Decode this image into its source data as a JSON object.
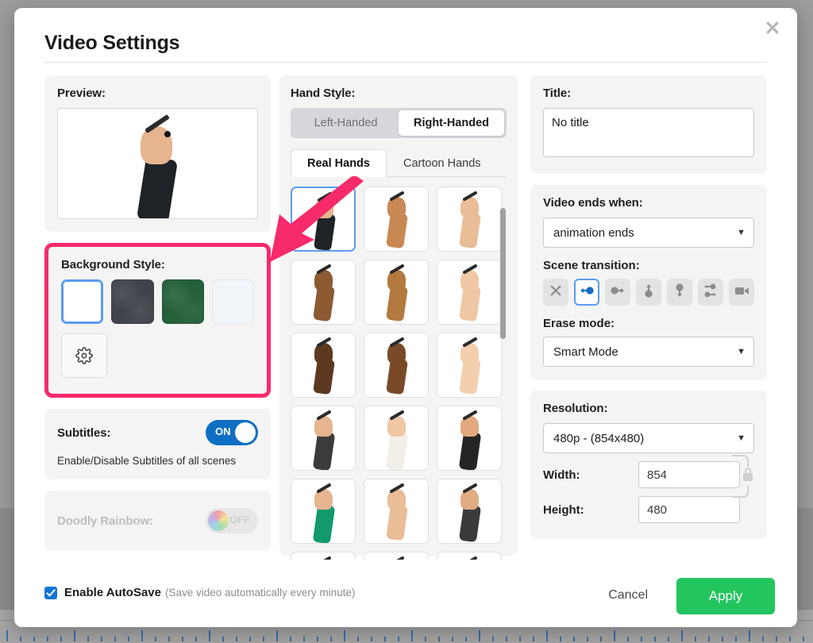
{
  "dialog": {
    "title": "Video Settings",
    "close_icon": "close-icon"
  },
  "left": {
    "preview": {
      "label": "Preview:"
    },
    "background_style": {
      "label": "Background Style:",
      "highlight_color": "#f72a6b",
      "swatches": [
        {
          "name": "white",
          "color": "#ffffff",
          "selected": true
        },
        {
          "name": "dark-chalkboard",
          "color": "#40434a",
          "selected": false
        },
        {
          "name": "green-chalkboard",
          "color": "#25603a",
          "selected": false
        },
        {
          "name": "light-gray",
          "color": "#f1f4f8",
          "selected": false
        }
      ],
      "settings_icon": "gear-icon"
    },
    "subtitles": {
      "label": "Subtitles:",
      "toggle_state": "ON",
      "hint": "Enable/Disable Subtitles of all scenes"
    },
    "doodly_rainbow": {
      "label": "Doodly Rainbow:",
      "toggle_state": "OFF",
      "disabled": true
    }
  },
  "middle": {
    "label": "Hand Style:",
    "handedness": {
      "options": [
        "Left-Handed",
        "Right-Handed"
      ],
      "selected": "Right-Handed"
    },
    "tabs": {
      "options": [
        "Real Hands",
        "Cartoon Hands"
      ],
      "selected": "Real Hands"
    },
    "hands": [
      {
        "id": 1,
        "skin": "#e6b48e",
        "sleeve": "#1f2227",
        "sleeve_h": 46,
        "selected": true
      },
      {
        "id": 2,
        "skin": "#c98954",
        "sleeve": "",
        "sleeve_h": 0,
        "selected": false
      },
      {
        "id": 3,
        "skin": "#e9bd97",
        "sleeve": "",
        "sleeve_h": 0,
        "selected": false
      },
      {
        "id": 4,
        "skin": "#8c5a33",
        "sleeve": "",
        "sleeve_h": 0,
        "selected": false
      },
      {
        "id": 5,
        "skin": "#b4793f",
        "sleeve": "",
        "sleeve_h": 0,
        "selected": false
      },
      {
        "id": 6,
        "skin": "#f0c7a4",
        "sleeve": "",
        "sleeve_h": 0,
        "selected": false
      },
      {
        "id": 7,
        "skin": "#5c3a22",
        "sleeve": "",
        "sleeve_h": 0,
        "selected": false
      },
      {
        "id": 8,
        "skin": "#7a4a28",
        "sleeve": "#7a4a28",
        "sleeve_h": 0,
        "selected": false
      },
      {
        "id": 9,
        "skin": "#f3cfae",
        "sleeve": "",
        "sleeve_h": 0,
        "selected": false
      },
      {
        "id": 10,
        "skin": "#e6b48e",
        "sleeve": "#3b3b3b",
        "sleeve_h": 48,
        "selected": false
      },
      {
        "id": 11,
        "skin": "#f0c7a4",
        "sleeve": "#f2efe9",
        "sleeve_h": 48,
        "selected": false
      },
      {
        "id": 12,
        "skin": "#e2a97f",
        "sleeve": "#242424",
        "sleeve_h": 48,
        "selected": false
      },
      {
        "id": 13,
        "skin": "#e6b48e",
        "sleeve": "#12996e",
        "sleeve_h": 48,
        "selected": false
      },
      {
        "id": 14,
        "skin": "#e9bd97",
        "sleeve": "",
        "sleeve_h": 0,
        "selected": false
      },
      {
        "id": 15,
        "skin": "#e0ac84",
        "sleeve": "#3a3a3c",
        "sleeve_h": 46,
        "selected": false
      },
      {
        "id": 16,
        "skin": "#e6b48e",
        "sleeve": "",
        "sleeve_h": 0,
        "selected": false
      },
      {
        "id": 17,
        "skin": "#d79e72",
        "sleeve": "",
        "sleeve_h": 0,
        "selected": false
      },
      {
        "id": 18,
        "skin": "#eec0a0",
        "sleeve": "",
        "sleeve_h": 0,
        "selected": false
      }
    ],
    "scrollbar": {
      "name": "hand-grid-scrollbar"
    }
  },
  "right": {
    "title_field": {
      "label": "Title:",
      "value": "No title",
      "placeholder": "No title"
    },
    "video_ends": {
      "label": "Video ends when:",
      "value": "animation ends"
    },
    "scene_transition": {
      "label": "Scene transition:",
      "options": [
        {
          "name": "none",
          "icon": "close-x-icon",
          "selected": false
        },
        {
          "name": "slide-left",
          "icon": "arrow-left-dot-icon",
          "selected": true
        },
        {
          "name": "slide-right",
          "icon": "arrow-right-dot-icon",
          "selected": false
        },
        {
          "name": "slide-up",
          "icon": "arrow-up-dot-icon",
          "selected": false
        },
        {
          "name": "slide-down",
          "icon": "arrow-down-dot-icon",
          "selected": false
        },
        {
          "name": "swap",
          "icon": "swap-arrows-icon",
          "selected": false
        },
        {
          "name": "camera",
          "icon": "video-camera-icon",
          "selected": false
        }
      ]
    },
    "erase_mode": {
      "label": "Erase mode:",
      "value": "Smart Mode"
    },
    "resolution": {
      "label": "Resolution:",
      "value": "480p  -  (854x480)"
    },
    "width": {
      "label": "Width:",
      "value": "854"
    },
    "height": {
      "label": "Height:",
      "value": "480"
    },
    "aspect_lock_icon": "lock-icon"
  },
  "footer": {
    "autosave_label": "Enable AutoSave",
    "autosave_note": "(Save video automatically every minute)",
    "autosave_checked": true,
    "cancel_label": "Cancel",
    "apply_label": "Apply",
    "apply_color": "#22c55e"
  },
  "annotation": {
    "arrow_color": "#f72a6b",
    "points_to": "background-style-section"
  }
}
